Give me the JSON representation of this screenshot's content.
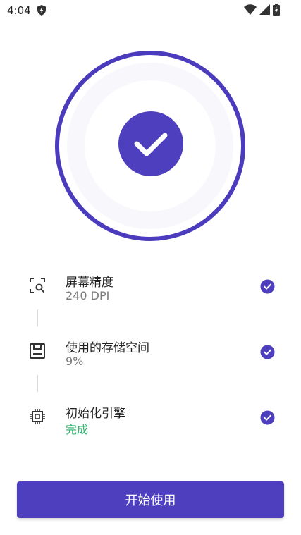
{
  "status_bar": {
    "time": "4:04",
    "icons": [
      "shield-icon",
      "wifi-icon",
      "signal-icon",
      "battery-charging-icon"
    ]
  },
  "colors": {
    "accent": "#4e3fbf",
    "ring": "#4b3bbd",
    "inner_circle": "#f3f2fb",
    "success_text": "#2db36b",
    "muted_text": "#7a7a7a"
  },
  "hero": {
    "icon": "checkmark-icon"
  },
  "items": [
    {
      "icon": "screen-scan-icon",
      "title": "屏幕精度",
      "value": "240 DPI",
      "status_icon": "check-circle-icon"
    },
    {
      "icon": "storage-icon",
      "title": "使用的存储空间",
      "value": "9%",
      "status_icon": "check-circle-icon"
    },
    {
      "icon": "chip-icon",
      "title": "初始化引擎",
      "value": "完成",
      "status_icon": "check-circle-icon"
    }
  ],
  "start_button": {
    "label": "开始使用"
  }
}
